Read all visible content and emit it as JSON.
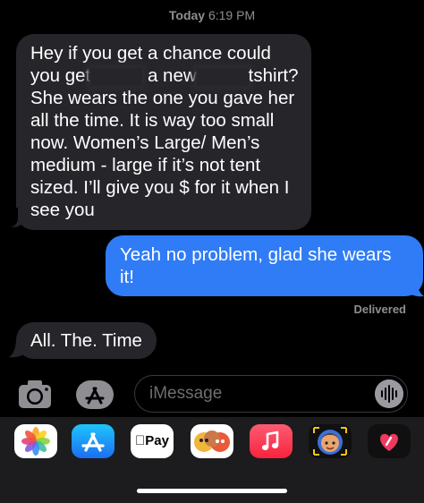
{
  "header": {
    "day": "Today",
    "time": "6:19 PM"
  },
  "messages": [
    {
      "direction": "received",
      "segments": [
        "Hey if you get a chance could",
        "you get",
        "a new",
        "tshirt?",
        "She wears the one you gave her",
        "all the time. It is way too small",
        "now. Women’s Large/ Men’s",
        "medium - large if it’s not tent",
        "sized. I’ll give you $ for it when I",
        "see you"
      ]
    },
    {
      "direction": "sent",
      "text": "Yeah no problem, glad she wears it!"
    },
    {
      "direction": "received",
      "text": "All. The. Time"
    }
  ],
  "status": {
    "delivered": "Delivered"
  },
  "composer": {
    "placeholder": "iMessage",
    "camera_icon": "camera-icon",
    "apps_icon": "app-store-icon",
    "audio_icon": "waveform-icon"
  },
  "app_drawer": {
    "apps": [
      {
        "name": "photos",
        "icon": "photos-icon"
      },
      {
        "name": "app-store",
        "icon": "app-store-icon"
      },
      {
        "name": "apple-pay",
        "icon": "apple-pay-icon",
        "label": "Pay"
      },
      {
        "name": "memoji-stickers",
        "icon": "memoji-stickers-icon"
      },
      {
        "name": "music",
        "icon": "music-note-icon"
      },
      {
        "name": "memoji",
        "icon": "memoji-icon"
      },
      {
        "name": "digital-touch",
        "icon": "heart-icon"
      }
    ]
  },
  "colors": {
    "sent_bubble": "#2f7cf6",
    "received_bubble": "#26252a",
    "background": "#000000",
    "drawer": "#1c1c1e"
  }
}
